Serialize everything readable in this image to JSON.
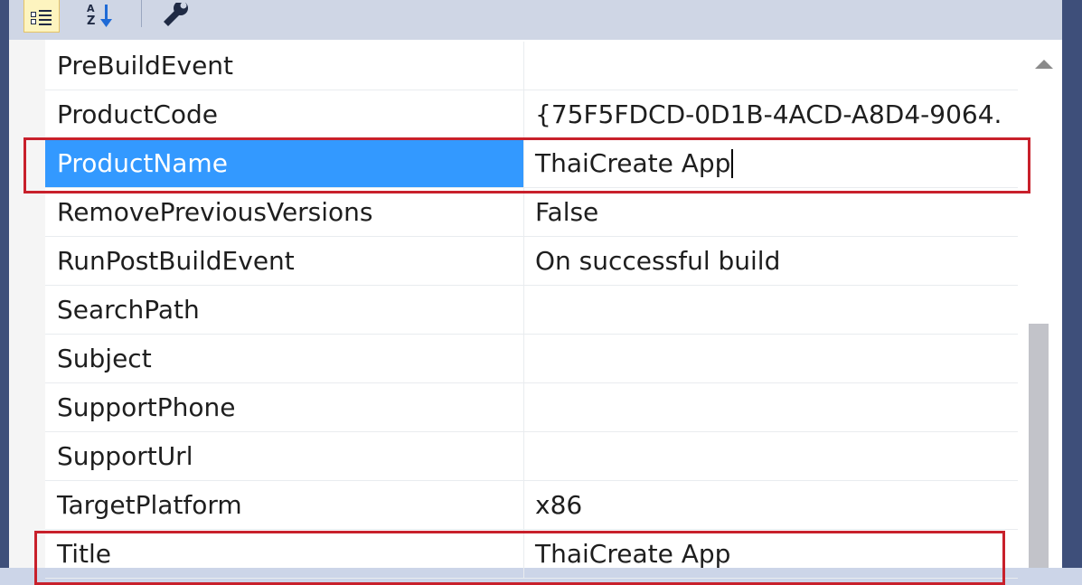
{
  "toolbar": {
    "buttons": [
      {
        "name": "categorized",
        "icon": "categorized-icon",
        "active": true
      },
      {
        "name": "alphabetical",
        "icon": "sort-az-icon",
        "active": false
      },
      {
        "name": "property-pages",
        "icon": "wrench-icon",
        "active": false
      }
    ]
  },
  "properties": [
    {
      "name": "PreBuildEvent",
      "value": ""
    },
    {
      "name": "ProductCode",
      "value": "{75F5FDCD-0D1B-4ACD-A8D4-9064."
    },
    {
      "name": "ProductName",
      "value": "ThaiCreate App"
    },
    {
      "name": "RemovePreviousVersions",
      "value": "False"
    },
    {
      "name": "RunPostBuildEvent",
      "value": "On successful build"
    },
    {
      "name": "SearchPath",
      "value": ""
    },
    {
      "name": "Subject",
      "value": ""
    },
    {
      "name": "SupportPhone",
      "value": ""
    },
    {
      "name": "SupportUrl",
      "value": ""
    },
    {
      "name": "TargetPlatform",
      "value": "x86"
    },
    {
      "name": "Title",
      "value": "ThaiCreate App"
    }
  ],
  "colors": {
    "selection": "#3399ff",
    "highlight_box": "#c8202b",
    "frame": "#3e4f7a"
  }
}
